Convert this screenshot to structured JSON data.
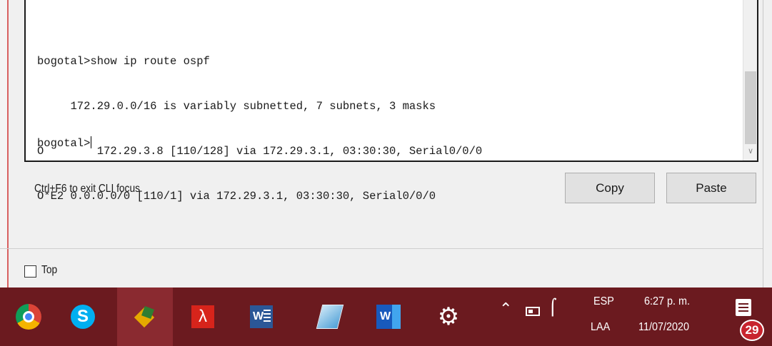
{
  "terminal": {
    "lines": [
      "bogotal>show ip route ospf",
      "     172.29.0.0/16 is variably subnetted, 7 subnets, 3 masks",
      "O        172.29.3.8 [110/128] via 172.29.3.1, 03:30:30, Serial0/0/0",
      "O*E2 0.0.0.0/0 [110/1] via 172.29.3.1, 03:30:30, Serial0/0/0",
      ""
    ],
    "prompt": "bogotal>"
  },
  "cli": {
    "hint": "Ctrl+F6 to exit CLI focus",
    "copy_label": "Copy",
    "paste_label": "Paste"
  },
  "window": {
    "top_label": "Top",
    "top_checked": false
  },
  "taskbar": {
    "apps": [
      {
        "name": "chrome-icon"
      },
      {
        "name": "skype-icon"
      },
      {
        "name": "packet-tracer-icon",
        "active": true
      },
      {
        "name": "acrobat-icon"
      },
      {
        "name": "word-icon"
      },
      {
        "name": "notes-icon"
      },
      {
        "name": "word-2019-icon"
      },
      {
        "name": "settings-icon"
      }
    ],
    "tray": {
      "lang_top": "ESP",
      "lang_bottom": "LAA",
      "time": "6:27 p. m.",
      "date": "11/07/2020",
      "notification_count": "29"
    }
  },
  "colors": {
    "taskbar": "#6b1a1f",
    "badge": "#c8242e"
  }
}
